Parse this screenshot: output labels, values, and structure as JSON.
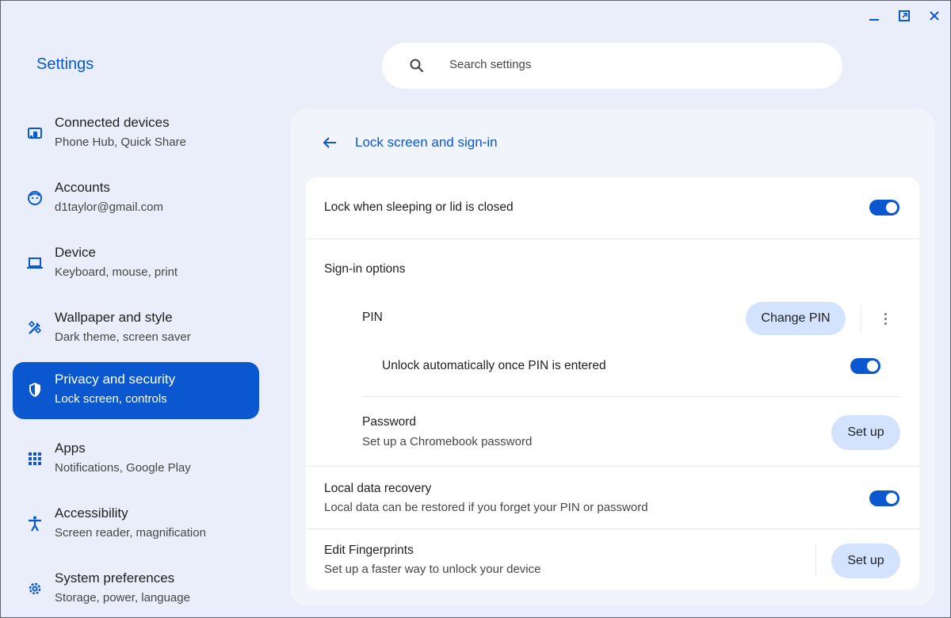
{
  "app": {
    "title": "Settings"
  },
  "window_controls": [
    "minimize-icon",
    "restore-icon",
    "close-icon"
  ],
  "search": {
    "placeholder": "Search settings"
  },
  "sidebar": {
    "items": [
      {
        "title": "Connected devices",
        "subtitle": "Phone Hub, Quick Share",
        "icon": "connected-devices-icon",
        "active": false
      },
      {
        "title": "Accounts",
        "subtitle": "d1taylor@gmail.com",
        "icon": "account-icon",
        "active": false
      },
      {
        "title": "Device",
        "subtitle": "Keyboard, mouse, print",
        "icon": "laptop-icon",
        "active": false
      },
      {
        "title": "Wallpaper and style",
        "subtitle": "Dark theme, screen saver",
        "icon": "brush-icon",
        "active": false
      },
      {
        "title": "Privacy and security",
        "subtitle": "Lock screen, controls",
        "icon": "shield-icon",
        "active": true
      },
      {
        "title": "Apps",
        "subtitle": "Notifications, Google Play",
        "icon": "apps-grid-icon",
        "active": false
      },
      {
        "title": "Accessibility",
        "subtitle": "Screen reader, magnification",
        "icon": "accessibility-icon",
        "active": false
      },
      {
        "title": "System preferences",
        "subtitle": "Storage, power, language",
        "icon": "gear-icon",
        "active": false
      }
    ]
  },
  "page": {
    "title": "Lock screen and sign-in",
    "lock_sleeping": {
      "label": "Lock when sleeping or lid is closed",
      "enabled": true
    },
    "signin_options": {
      "label": "Sign-in options"
    },
    "pin": {
      "label": "PIN",
      "button": "Change PIN",
      "unlock_auto": {
        "label": "Unlock automatically once PIN is entered",
        "enabled": true
      }
    },
    "password": {
      "label": "Password",
      "subtitle": "Set up a Chromebook password",
      "button": "Set up"
    },
    "local_recovery": {
      "label": "Local data recovery",
      "subtitle": "Local data can be restored if you forget your PIN or password",
      "enabled": true
    },
    "fingerprints": {
      "label": "Edit Fingerprints",
      "subtitle": "Set up a faster way to unlock your device",
      "button": "Set up"
    }
  },
  "colors": {
    "accent": "#0b57d0",
    "background": "#e9eefa",
    "tonal_button": "#d3e3fd"
  }
}
